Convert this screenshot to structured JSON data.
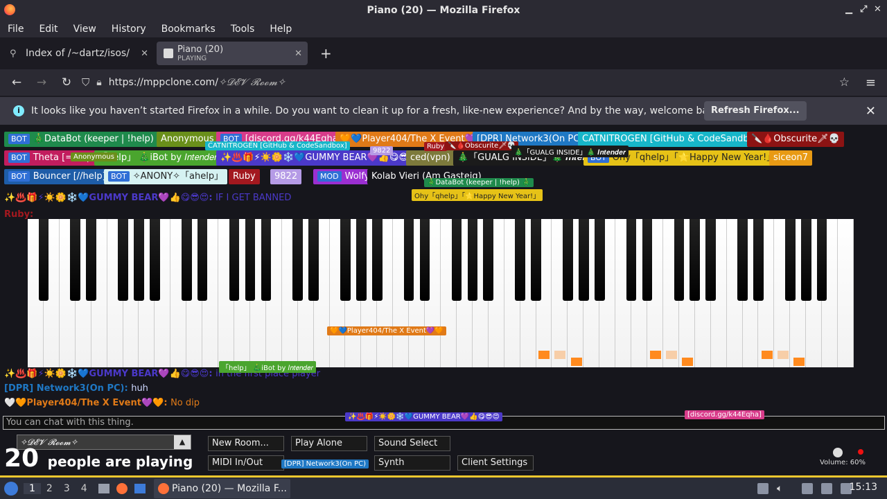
{
  "window": {
    "title": "Piano (20) — Mozilla Firefox"
  },
  "menu": [
    "File",
    "Edit",
    "View",
    "History",
    "Bookmarks",
    "Tools",
    "Help"
  ],
  "tabs": [
    {
      "label": "Index of /~dartz/isos/",
      "sub": ""
    },
    {
      "label": "Piano (20)",
      "sub": "PLAYING"
    }
  ],
  "url": {
    "prefix": "https://mppclone.com/",
    "room": "✧𝓓𝓔𝓥 𝓡𝓸𝓸𝓶✧"
  },
  "notification": {
    "text": "It looks like you haven’t started Firefox in a while. Do you want to clean it up for a fresh, like-new experience? And by the way, welcome back!",
    "button": "Refresh Firefox..."
  },
  "users_row1": [
    {
      "tag": "BOT",
      "name": "🎄DataBot (keeper | !help) 🎄",
      "color": "#1f8a4c"
    },
    {
      "tag": "",
      "name": "Anonymous",
      "color": "#6a8f1a"
    },
    {
      "tag": "BOT",
      "name": "[discord.gg/k44Eqha]",
      "color": "#d83b8a"
    },
    {
      "tag": "",
      "name": "🧡💙Player404/The X Event💜🧡",
      "color": "#e07a18"
    },
    {
      "tag": "",
      "name": "[DPR] Network3(On PC)",
      "color": "#1f78c4"
    },
    {
      "tag": "",
      "name": "CATNITROGEN [GitHub & CodeSandbox]",
      "color": "#17b6c9"
    },
    {
      "tag": "",
      "name": "🔪🩸Obscurite🗡💀",
      "color": "#8c1313"
    }
  ],
  "users_row2": [
    {
      "tag": "BOT",
      "name": "Theta [=help]",
      "color": "#c21d5e"
    },
    {
      "tag": "",
      "name": "「help」 🎄iBot by 𝐼𝑛𝑡𝑒𝑛𝑑𝑒𝑟",
      "color": "#4aa52e"
    },
    {
      "tag": "",
      "name": "✨♨️🎁⚡☀️🌼❄️💙GUMMY BEAR💜👍😋😎😍",
      "color": "#4b39c9"
    },
    {
      "tag": "",
      "name": "ced(vpn)",
      "color": "#7d7a3c"
    },
    {
      "tag": "",
      "name": "🎄「GUALG INSIDE」🎄 𝑰𝒏𝒕𝒆𝒏𝒅𝒆𝒓",
      "color": "#1b1b1b"
    },
    {
      "tag": "BOT",
      "name": "Ohy「qhelp」「🌟Happy New Year!」",
      "color": "#e6c217"
    },
    {
      "tag": "",
      "name": "siceon7",
      "color": "#e89a14"
    }
  ],
  "users_row3": [
    {
      "tag": "BOT",
      "name": "Bouncer [//help]",
      "color": "#1e5da8"
    },
    {
      "tag": "BOT",
      "name": "✧ANONY✧「ahelp」",
      "color": "#d6f2f2"
    },
    {
      "tag": "",
      "name": "Ruby",
      "color": "#a3181f"
    },
    {
      "tag": "",
      "name": "9822",
      "color": "#b59be6"
    },
    {
      "tag": "MOD",
      "name": "Wolfy",
      "color": "#9b2fd1"
    },
    {
      "tag": "",
      "name": "Kolab Vieri (Am Gasteig)",
      "color": "#16161c"
    }
  ],
  "chat_log": [
    {
      "name": "✨♨️🎁⚡☀️🌼❄️💙GUMMY BEAR💜👍😋😎😍:",
      "msg": "IF I GET BANNED",
      "color": "#4b39c9",
      "mcolor": "#4b39c9"
    },
    {
      "name": "Ruby:",
      "msg": "",
      "color": "#a3181f",
      "mcolor": "#a3181f"
    },
    {
      "name": "✨♨️🎁⚡☀️🌼❄️💙GUMMY BEAR💜👍😋😎😍:",
      "msg": "in the first place player",
      "color": "#4b39c9",
      "mcolor": "#4b39c9"
    },
    {
      "name": "[DPR] Network3(On PC):",
      "msg": "huh",
      "color": "#1f78c4",
      "mcolor": "#cfd8ff"
    },
    {
      "name": "🤍🧡Player404/The X Event💜🧡:",
      "msg": "No dip",
      "color": "#e07a18",
      "mcolor": "#e07a18"
    }
  ],
  "floating_tags": [
    {
      "name": "CATNITROGEN [GitHub & CodeSandbox]",
      "color": "#17b6c9"
    },
    {
      "name": "9822",
      "color": "#b59be6"
    },
    {
      "name": "Ruby",
      "color": "#a3181f"
    },
    {
      "name": "🔪🩸Obscurite🗡💀",
      "color": "#8c1313"
    },
    {
      "name": "🎄「GUALG INSIDE」🎄 𝑰𝒏𝒕𝒆𝒏𝒅𝒆𝒓",
      "color": "#1b1b1b"
    },
    {
      "name": "Anonymous",
      "color": "#6a8f1a"
    },
    {
      "name": "🎄DataBot (keeper | !help) 🎄",
      "color": "#1f8a4c"
    },
    {
      "name": "Ohy「qhelp」「🌟Happy New Year!」",
      "color": "#e6c217"
    },
    {
      "name": "🧡💙Player404/The X Event💜🧡",
      "color": "#e07a18"
    },
    {
      "name": "「help」 🎄iBot by 𝐼𝑛𝑡𝑒𝑛𝑑𝑒𝑟",
      "color": "#4aa52e"
    },
    {
      "name": "✨♨️🎁⚡☀️🌼❄️💙GUMMY BEAR💜👍😋😎😍",
      "color": "#4b39c9"
    },
    {
      "name": "[discord.gg/k44Eqha]",
      "color": "#d83b8a"
    },
    {
      "name": "[DPR] Network3(On PC)",
      "color": "#1f78c4"
    }
  ],
  "chat_input": {
    "placeholder": "You can chat with this thing."
  },
  "room_select": {
    "value": "✧𝓓𝓔𝓥 𝓡𝓸𝓸𝓶✧"
  },
  "players": {
    "count": "20",
    "label": "people are playing"
  },
  "buttons": [
    "New Room...",
    "Play Alone",
    "Sound Select",
    "MIDI In/Out",
    "Synth",
    "Client Settings"
  ],
  "volume": {
    "label": "Volume: 60%",
    "level": 0.6
  },
  "taskbar": {
    "workspaces": [
      "1",
      "2",
      "3",
      "4"
    ],
    "task": "Piano (20) — Mozilla F...",
    "clock": "15:13"
  }
}
